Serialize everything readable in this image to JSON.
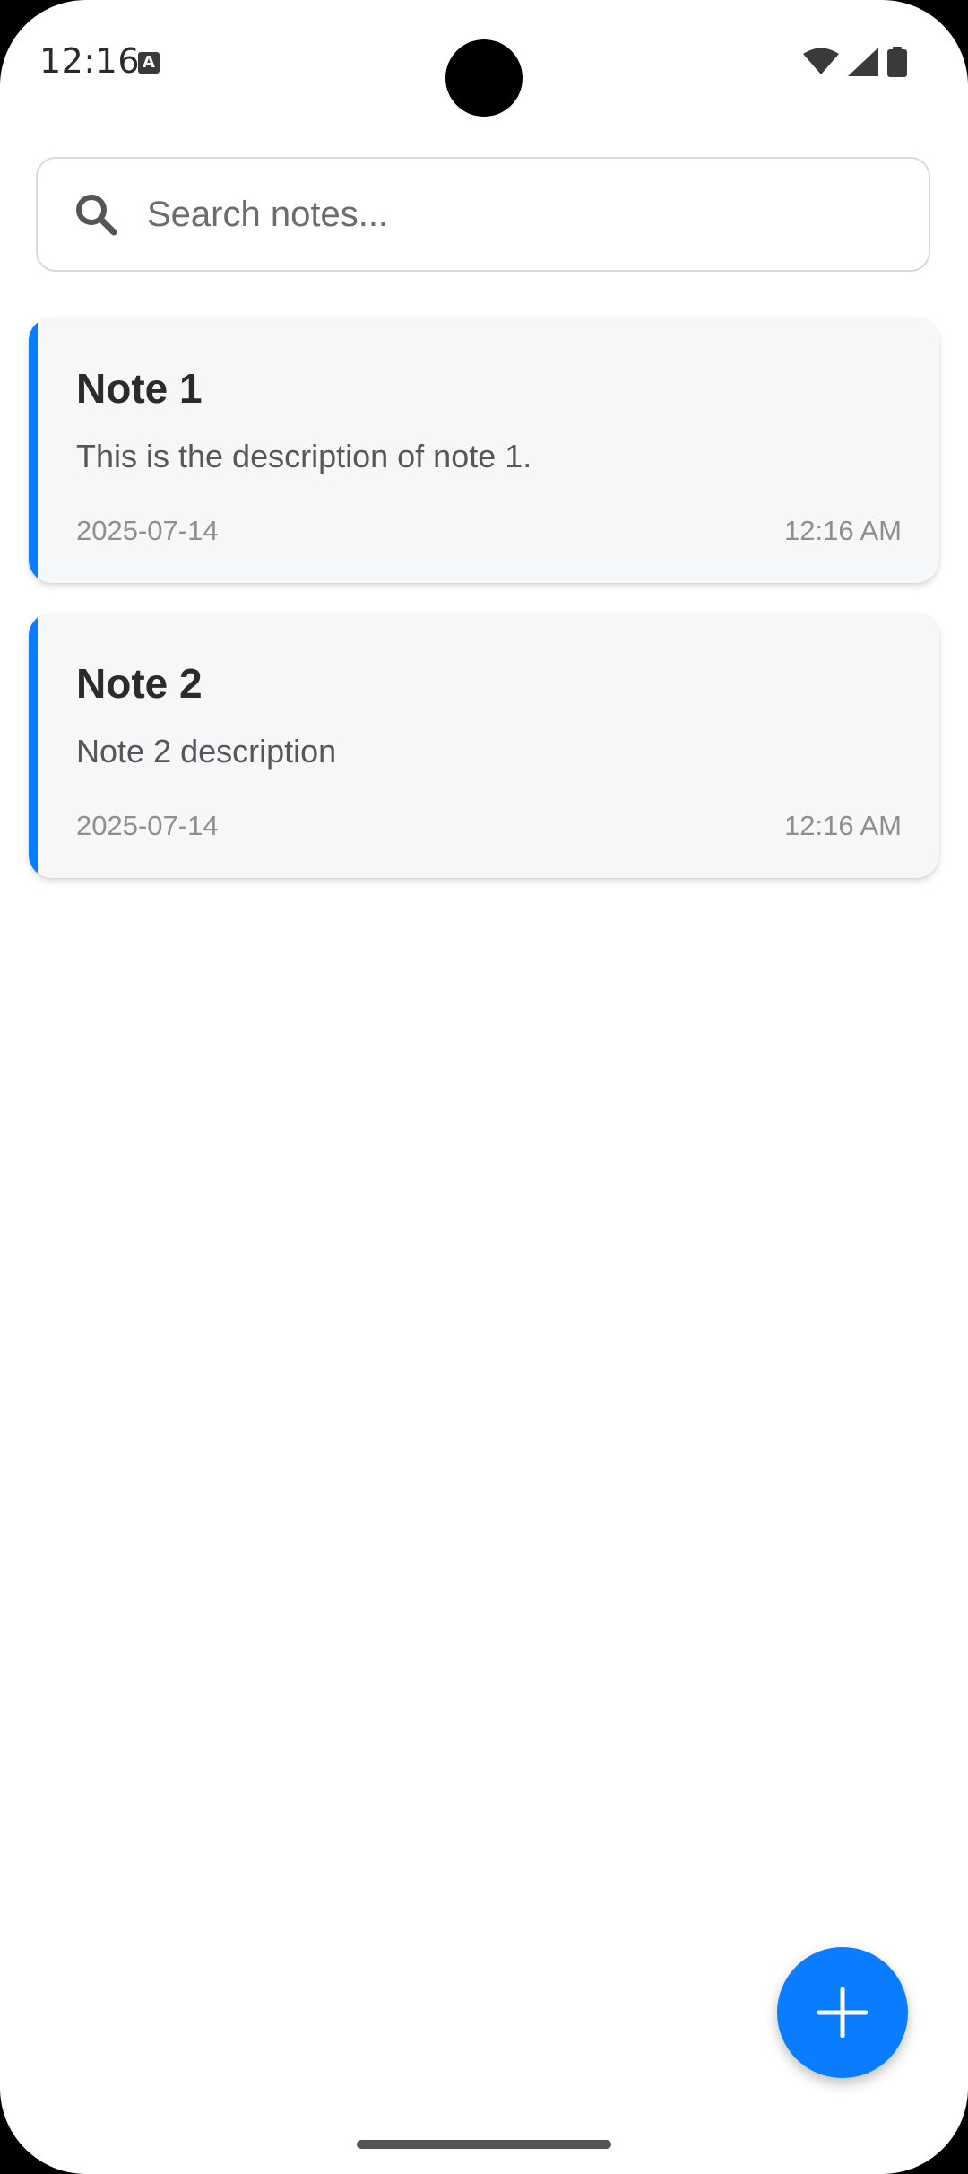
{
  "status_bar": {
    "time": "12:16",
    "notification_icon": "A"
  },
  "search": {
    "placeholder": "Search notes...",
    "value": ""
  },
  "notes": [
    {
      "title": "Note 1",
      "description": "This is the description of note 1.",
      "date": "2025-07-14",
      "time": "12:16 AM"
    },
    {
      "title": "Note 2",
      "description": "Note 2 description",
      "date": "2025-07-14",
      "time": "12:16 AM"
    }
  ],
  "fab": {
    "icon": "plus-icon"
  },
  "colors": {
    "accent": "#0a7cff",
    "card_background": "#f6f7f9",
    "title_text": "#2b2b2e",
    "muted_text": "#8e8e93"
  }
}
